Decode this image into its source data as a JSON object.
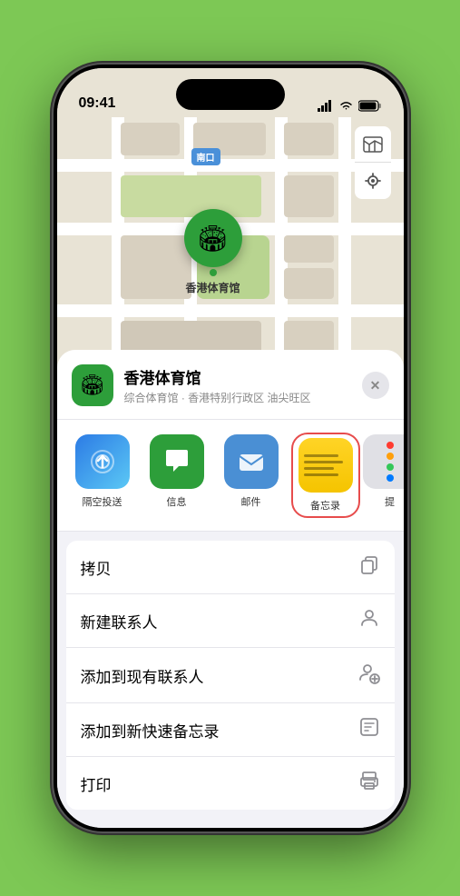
{
  "phone": {
    "status_bar": {
      "time": "09:41",
      "signal_icon": "signal",
      "wifi_icon": "wifi",
      "battery_icon": "battery"
    },
    "map": {
      "tag_label": "南口",
      "pin_emoji": "🏟",
      "pin_label": "香港体育馆"
    },
    "map_controls": {
      "map_btn": "🗺",
      "location_btn": "⬆"
    },
    "location_header": {
      "title": "香港体育馆",
      "subtitle": "综合体育馆 · 香港特别行政区 油尖旺区",
      "close_label": "✕"
    },
    "share_items": [
      {
        "id": "airdrop",
        "label": "隔空投送",
        "type": "airdrop"
      },
      {
        "id": "messages",
        "label": "信息",
        "type": "messages"
      },
      {
        "id": "mail",
        "label": "邮件",
        "type": "mail"
      },
      {
        "id": "notes",
        "label": "备忘录",
        "type": "notes"
      },
      {
        "id": "more",
        "label": "提",
        "type": "more"
      }
    ],
    "action_items": [
      {
        "label": "拷贝",
        "icon": "📋"
      },
      {
        "label": "新建联系人",
        "icon": "👤"
      },
      {
        "label": "添加到现有联系人",
        "icon": "👤"
      },
      {
        "label": "添加到新快速备忘录",
        "icon": "📝"
      },
      {
        "label": "打印",
        "icon": "🖨"
      }
    ]
  }
}
